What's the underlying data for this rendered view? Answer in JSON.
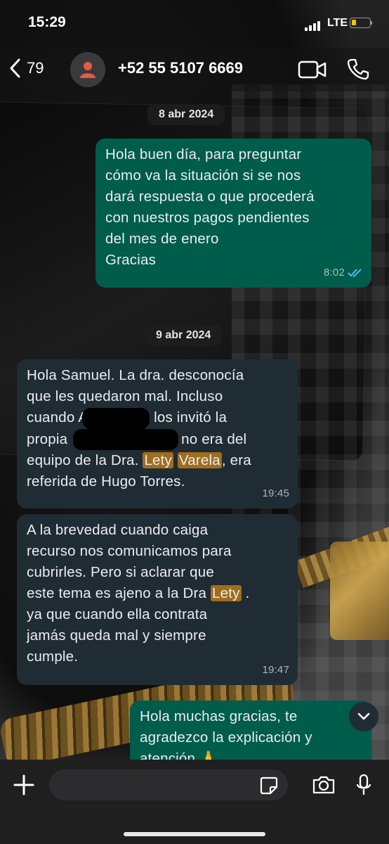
{
  "status_bar": {
    "time": "15:29",
    "network": "LTE"
  },
  "header": {
    "back_count": "79",
    "contact": "+52 55 5107 6669"
  },
  "colors": {
    "outgoing_bubble": "#005c4b",
    "incoming_bubble": "#202c33",
    "highlight": "#a06d1f",
    "read_ticks": "#53bdeb"
  },
  "chat": {
    "date_1": "8 abr 2024",
    "msg1": {
      "lines": [
        "Hola buen día, para preguntar",
        "cómo va la situación si se nos",
        "dará respuesta o que procederá",
        "con nuestros pagos pendientes",
        "del mes de enero",
        "Gracias"
      ],
      "time": "8:02"
    },
    "date_2": "9 abr 2024",
    "msg2": {
      "l1": "Hola Samuel. La dra. desconocía",
      "l2": "que les quedaron mal. Incluso",
      "l3a": "cuando A",
      "l3b": "los invitó la",
      "l4a": "propia",
      "l4b": "no era del",
      "l5a": "equipo de la Dra.",
      "hl1": "Lety",
      "hl2": "Varela",
      "l5b": ", era",
      "l6": "referida de Hugo Torres.",
      "time": "19:45"
    },
    "msg3": {
      "l1": "A la brevedad cuando caiga",
      "l2": "recurso nos comunicamos para",
      "l3": "cubrirles. Pero si aclarar que",
      "l4a": "este tema es ajeno a la Dra",
      "hl": "Lety",
      "l4b": " .",
      "l5": "ya que cuando ella contrata",
      "l6": "jamás queda mal y siempre",
      "l7": "cumple.",
      "time": "19:47"
    },
    "msg4": {
      "l1": "Hola muchas gracias, te",
      "l2": "agradezco la explicación y",
      "l3": "atención 🙏"
    }
  },
  "input": {
    "placeholder": ""
  }
}
